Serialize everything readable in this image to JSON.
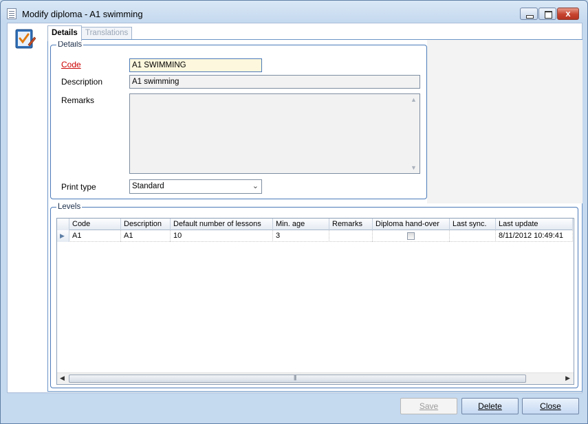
{
  "window": {
    "title": "Modify diploma  - A1 swimming",
    "controls": {
      "minimize": "minimize",
      "maximize": "maximize",
      "close": "x"
    }
  },
  "tabs": [
    {
      "label": "Details",
      "active": true
    },
    {
      "label": "Translations",
      "active": false
    }
  ],
  "details": {
    "legend": "Details",
    "code_label": "Code",
    "code_value": "A1 SWIMMING",
    "description_label": "Description",
    "description_value": "A1 swimming",
    "remarks_label": "Remarks",
    "remarks_value": "",
    "print_type_label": "Print type",
    "print_type_value": "Standard"
  },
  "levels": {
    "legend": "Levels",
    "columns": [
      "Code",
      "Description",
      "Default number of lessons",
      "Min. age",
      "Remarks",
      "Diploma hand-over",
      "Last sync.",
      "Last update"
    ],
    "rows": [
      {
        "code": "A1",
        "description": "A1",
        "default_lessons": "10",
        "min_age": "3",
        "remarks": "",
        "diploma_handover": false,
        "last_sync": "",
        "last_update": "8/11/2012 10:49:41"
      }
    ]
  },
  "buttons": {
    "save": "Save",
    "delete": "Delete",
    "close": "Close"
  },
  "icons": {
    "window": "document-icon",
    "app": "checklist-pen-icon",
    "row_indicator": "row-pointer-icon"
  },
  "colors": {
    "required_label": "#cc0000",
    "code_field_bg": "#fdf8dd",
    "accent_border": "#4a79b8"
  }
}
